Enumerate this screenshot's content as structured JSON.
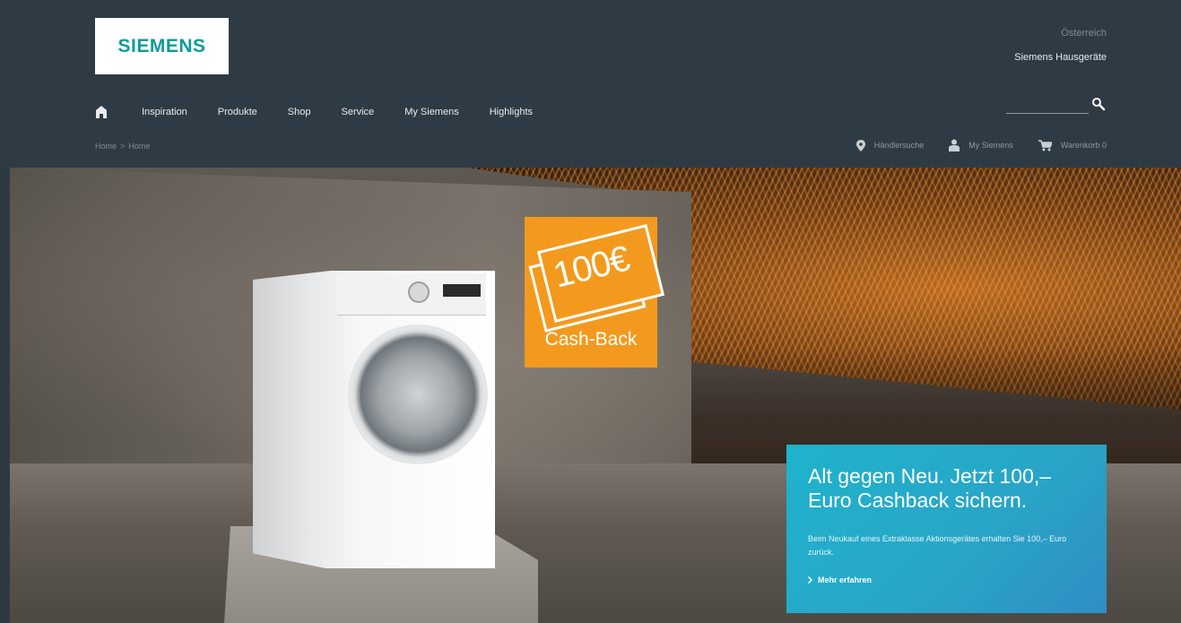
{
  "header": {
    "logo_text": "SIEMENS",
    "country": "Österreich",
    "brand_link": "Siemens Hausgeräte"
  },
  "nav": {
    "items": [
      {
        "label": "Inspiration"
      },
      {
        "label": "Produkte"
      },
      {
        "label": "Shop"
      },
      {
        "label": "Service"
      },
      {
        "label": "My Siemens"
      },
      {
        "label": "Highlights"
      }
    ]
  },
  "search": {
    "value": "",
    "placeholder": ""
  },
  "breadcrumb": {
    "home": "Home",
    "separator": ">",
    "current": "Home"
  },
  "utility": {
    "dealer_search": "Händlersuche",
    "my_siemens": "My Siemens",
    "cart": "Warenkorb 0"
  },
  "hero": {
    "cashback_amount": "100€",
    "cashback_label": "Cash-Back"
  },
  "promo": {
    "title": "Alt gegen Neu. Jetzt 100,– Euro Cashback sichern.",
    "text": "Beim Neukauf eines Extraklasse Aktionsgerätes erhalten Sie 100,– Euro zurück.",
    "link": "Mehr erfahren"
  },
  "colors": {
    "header_bg": "#2f3b44",
    "brand_teal": "#0d9b9b",
    "promo_blue": "#28a6c8",
    "cashback_orange": "#f39a1e"
  },
  "icons": [
    "home-icon",
    "search-icon",
    "location-pin-icon",
    "user-icon",
    "cart-icon",
    "chevron-right-icon"
  ]
}
